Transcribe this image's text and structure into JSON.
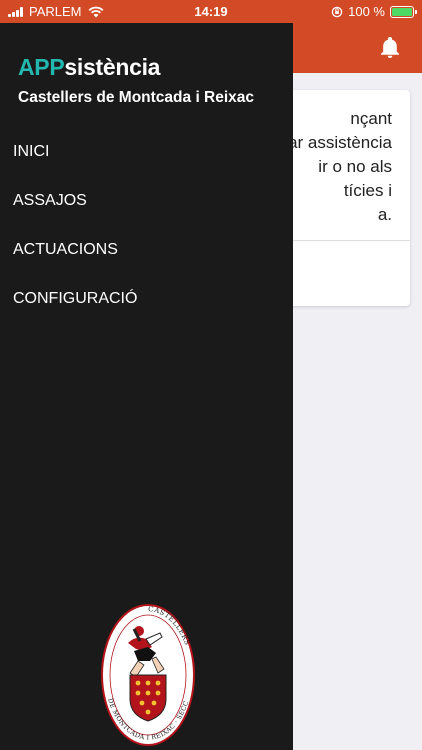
{
  "status_bar": {
    "carrier": "PARLEM",
    "time": "14:19",
    "battery": "100 %"
  },
  "drawer": {
    "brand_app": "APP",
    "brand_rest": "sistència",
    "subtitle": "Castellers de Montcada i Reixac",
    "menu": [
      "INICI",
      "ASSAJOS",
      "ACTUACIONS",
      "CONFIGURACIÓ"
    ]
  },
  "card": {
    "lines": [
      "nçant",
      "ar assistència",
      "ir o no als",
      "tícies i",
      "a."
    ]
  },
  "logo": {
    "text_right": "CASTELLERS",
    "text_bottom": "DE MONTCADA I REIXAC · SECCIÓ ABI"
  },
  "colors": {
    "header": "#d24a26",
    "drawer": "#1a1a1a",
    "brand_accent": "#22b8b0"
  }
}
